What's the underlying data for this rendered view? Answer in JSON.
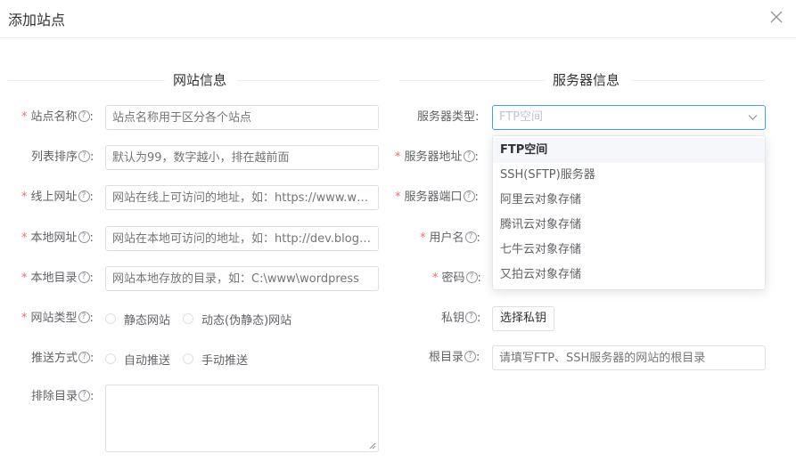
{
  "dialog": {
    "title": "添加站点"
  },
  "sections": {
    "website": "网站信息",
    "server": "服务器信息"
  },
  "help_glyph": "?",
  "required_mark": "*",
  "left_fields": {
    "site_name": {
      "label": "站点名称",
      "placeholder": "站点名称用于区分各个站点",
      "required": true
    },
    "sort_order": {
      "label": "列表排序",
      "placeholder": "默认为99，数字越小，排在越前面",
      "required": false
    },
    "online_url": {
      "label": "线上网址",
      "placeholder": "网站在线上可访问的地址，如：https://www.wordpress.org",
      "required": true
    },
    "local_url": {
      "label": "本地网址",
      "placeholder": "网站在本地可访问的地址，如：http://dev.blog.com",
      "required": true
    },
    "local_dir": {
      "label": "本地目录",
      "placeholder": "网站本地存放的目录，如：C:\\www\\wordpress",
      "required": true
    },
    "site_type": {
      "label": "网站类型",
      "required": true,
      "options": [
        "静态网站",
        "动态(伪静态)网站"
      ]
    },
    "push_mode": {
      "label": "推送方式",
      "required": false,
      "options": [
        "自动推送",
        "手动推送"
      ]
    },
    "exclude_dir": {
      "label": "排除目录",
      "required": false
    }
  },
  "right_fields": {
    "server_type": {
      "label": "服务器类型",
      "selected": "FTP空间",
      "required": false
    },
    "server_addr": {
      "label": "服务器地址",
      "required": true
    },
    "server_port": {
      "label": "服务器端口",
      "required": true
    },
    "username": {
      "label": "用户名",
      "required": true
    },
    "password": {
      "label": "密码",
      "required": true
    },
    "private_key": {
      "label": "私钥",
      "button": "选择私钥",
      "required": false
    },
    "root_dir": {
      "label": "根目录",
      "placeholder": "请填写FTP、SSH服务器的网站的根目录",
      "required": false
    }
  },
  "server_type_options": [
    "FTP空间",
    "SSH(SFTP)服务器",
    "阿里云对象存储",
    "腾讯云对象存储",
    "七牛云对象存储",
    "又拍云对象存储"
  ],
  "colors": {
    "accent": "#409eff",
    "required": "#f56c6c",
    "border": "#dcdfe6"
  }
}
